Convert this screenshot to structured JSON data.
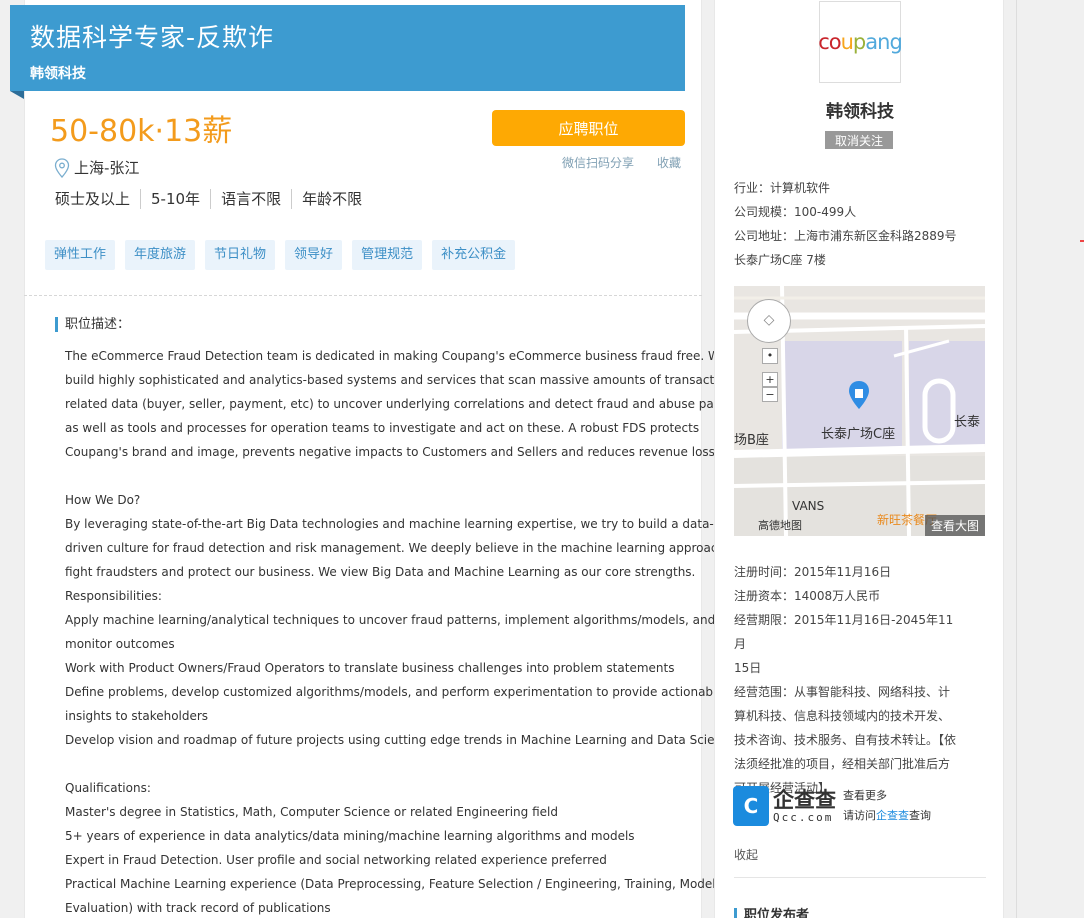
{
  "job": {
    "title": "数据科学专家-反欺诈",
    "company": "韩领科技",
    "salary": "50-80k·13薪",
    "apply_label": "应聘职位",
    "share_label": "微信扫码分享",
    "favorite_label": "收藏",
    "location": "上海-张江",
    "requirements": [
      "硕士及以上",
      "5-10年",
      "语言不限",
      "年龄不限"
    ],
    "tags": [
      "弹性工作",
      "年度旅游",
      "节日礼物",
      "领导好",
      "管理规范",
      "补充公积金"
    ]
  },
  "description": {
    "heading": "职位描述：",
    "lines": [
      "The eCommerce Fraud Detection team is dedicated in making Coupang's eCommerce business fraud free. We",
      "build highly sophisticated and analytics-based systems and services that scan massive amounts of transaction-",
      "related data (buyer, seller, payment, etc) to uncover underlying correlations and detect fraud and abuse patterns,",
      "as well as tools and processes for operation teams to investigate and act on these. A robust FDS protects",
      "Coupang's brand and image, prevents negative impacts to Customers and Sellers and reduces revenue loss.",
      "",
      "How We Do?",
      "By leveraging state-of-the-art Big Data technologies and machine learning expertise, we try to build a data-",
      "driven culture for fraud detection and risk management. We deeply believe in the machine learning approach to",
      "fight fraudsters and protect our business. We view Big Data and Machine Learning as our core strengths.",
      "Responsibilities:",
      "Apply machine learning/analytical techniques to uncover fraud patterns, implement algorithms/models, and",
      "monitor outcomes",
      "Work with Product Owners/Fraud Operators to translate business challenges into problem statements",
      "Define problems, develop customized algorithms/models, and perform experimentation to provide actionable",
      "insights to stakeholders",
      "Develop vision and roadmap of future projects using cutting edge trends in Machine Learning and Data Science",
      "",
      "Qualifications:",
      "Master's degree in Statistics, Math, Computer Science or related Engineering field",
      "5+ years of experience in data analytics/data mining/machine learning algorithms and models",
      "Expert in Fraud Detection. User profile and social networking related experience preferred",
      "Practical Machine Learning experience (Data Preprocessing, Feature Selection / Engineering, Training, Model",
      "Evaluation) with track record of publications"
    ]
  },
  "sidebar": {
    "logo_text": "coupang",
    "logo_colors": [
      "#c9252c",
      "#c9252c",
      "#f7a51c",
      "#9ab13a",
      "#51a9dc",
      "#51a9dc",
      "#51a9dc"
    ],
    "company_name": "韩领科技",
    "unfollow_label": "取消关注",
    "industry": "行业：计算机软件",
    "size": "公司规模：100-499人",
    "address_1": "公司地址：上海市浦东新区金科路2889号",
    "address_2": "长泰广场C座 7楼",
    "map": {
      "label_main": "长泰广场C座",
      "label_left": "场B座",
      "label_right": "长泰",
      "label_vans": "VANS",
      "label_tea": "新旺茶餐厅",
      "provider": "高德地图",
      "view_large": "查看大图",
      "zoom_in": "+",
      "zoom_out": "−"
    },
    "registered": "注册时间：2015年11月16日",
    "capital": "注册资本：14008万人民币",
    "term_1": "经营期限：2015年11月16日-2045年11月",
    "term_2": "15日",
    "scope_1": "经营范围：从事智能科技、网络科技、计",
    "scope_2": "算机科技、信息科技领域内的技术开发、",
    "scope_3": "技术咨询、技术服务、自有技术转让。【依",
    "scope_4": "法须经批准的项目，经相关部门批准后方",
    "scope_5": "可开展经营活动】",
    "qcc_big": "企查查",
    "qcc_small": "Qcc.com",
    "qcc_more": "查看更多",
    "qcc_visit_pre": "请访问",
    "qcc_visit_link": "企查查",
    "qcc_visit_post": "查询",
    "collapse_label": "收起",
    "publisher_heading": "职位发布者"
  },
  "colors": {
    "brand_blue": "#3d9bd0",
    "salary_orange": "#f39b1c",
    "apply_orange": "#fea903",
    "tag_bg": "#eaf3fb",
    "tag_text": "#3d8fc6"
  }
}
